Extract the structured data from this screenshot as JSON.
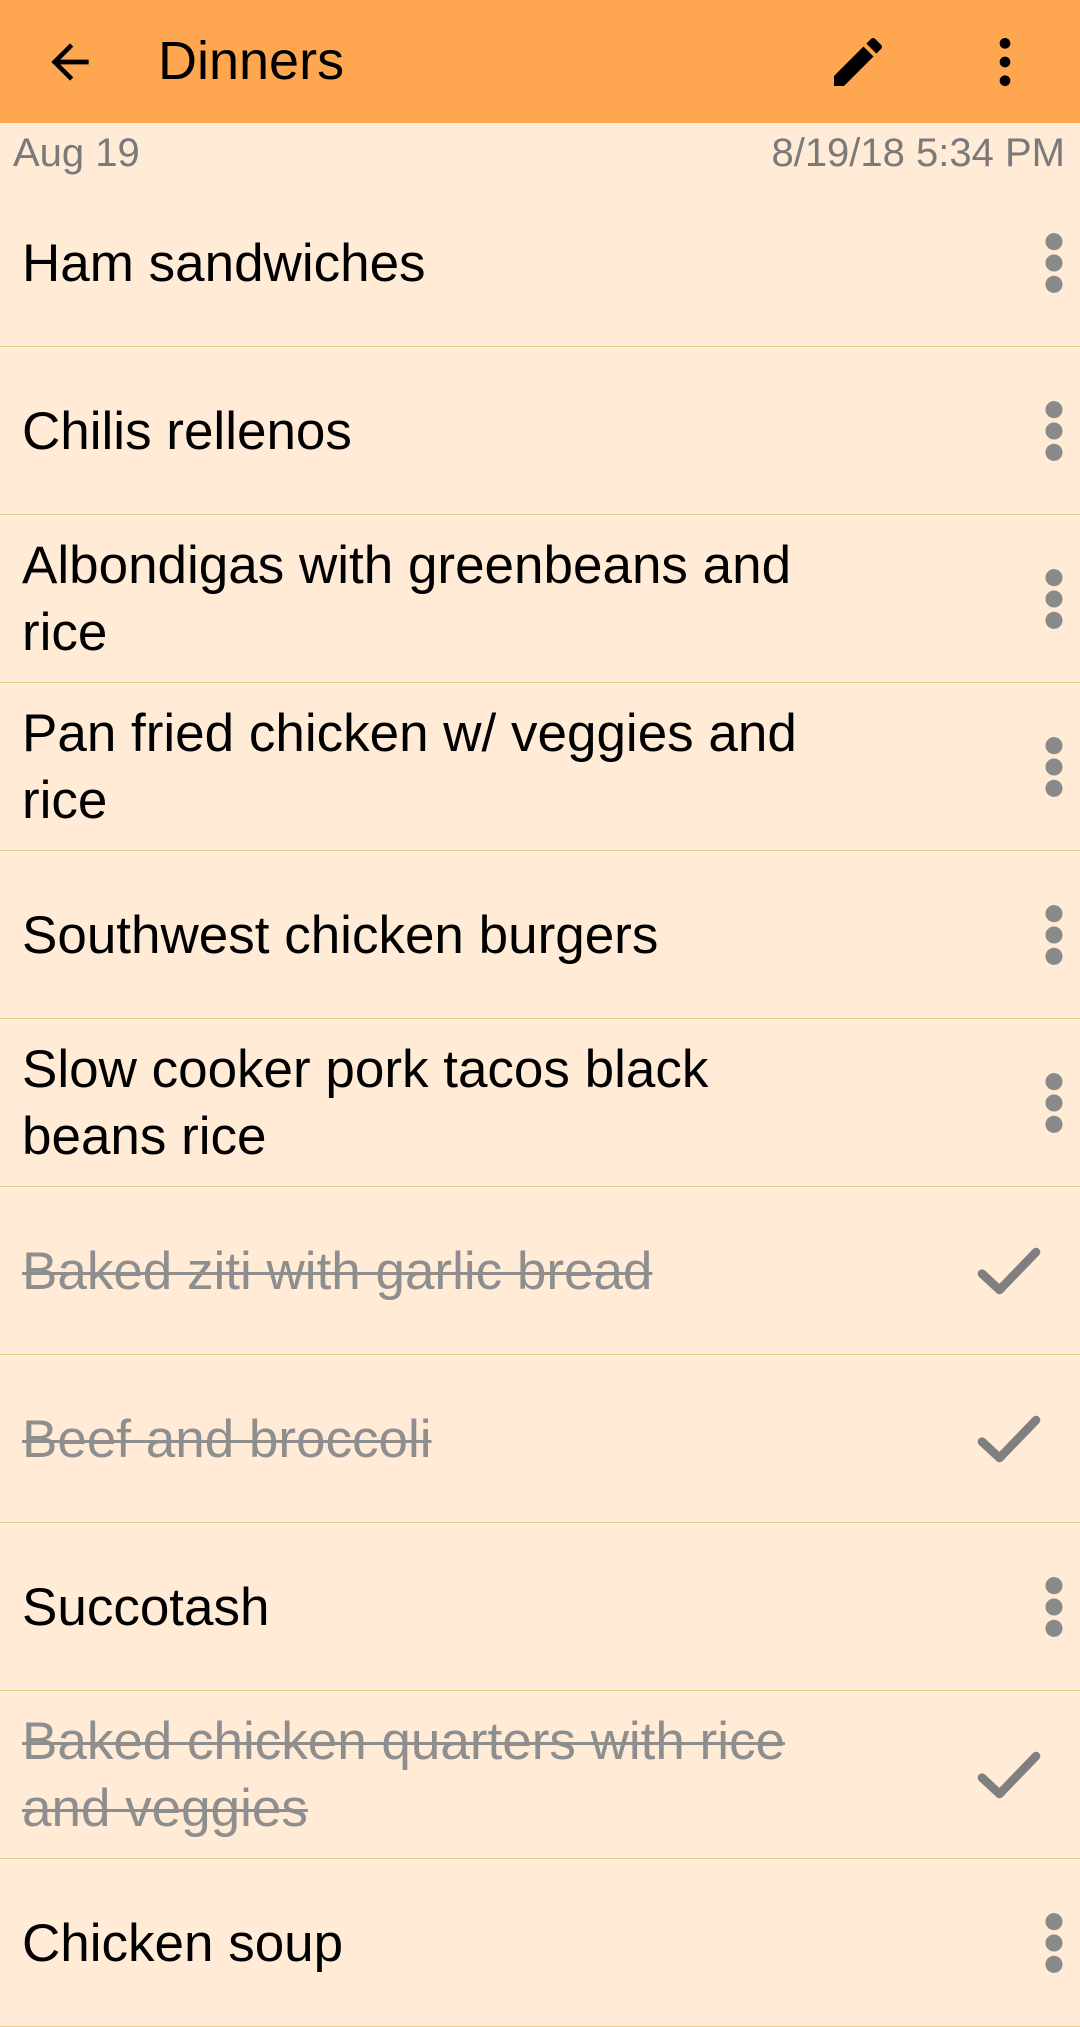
{
  "appbar": {
    "title": "Dinners",
    "back_icon": "arrow-left-icon",
    "edit_icon": "pencil-icon",
    "more_icon": "more-vertical-icon",
    "background_color": "#FFA650"
  },
  "meta": {
    "date_short": "Aug 19",
    "date_full": "8/19/18 5:34 PM"
  },
  "items": [
    {
      "label": "Ham sandwiches",
      "done": false
    },
    {
      "label": "Chilis rellenos",
      "done": false
    },
    {
      "label": "Albondigas with greenbeans and rice",
      "done": false
    },
    {
      "label": "Pan fried chicken w/ veggies and rice",
      "done": false
    },
    {
      "label": "Southwest chicken burgers",
      "done": false
    },
    {
      "label": "Slow cooker pork tacos black beans rice",
      "done": false
    },
    {
      "label": "Baked ziti with garlic bread",
      "done": true
    },
    {
      "label": "Beef and broccoli",
      "done": true
    },
    {
      "label": "Succotash",
      "done": false
    },
    {
      "label": "Baked chicken quarters with rice and veggies",
      "done": true
    },
    {
      "label": "Chicken soup",
      "done": false
    }
  ],
  "colors": {
    "background": "#FFEBD6",
    "divider": "#E6CC8E",
    "done_text": "#8E8E8E"
  }
}
